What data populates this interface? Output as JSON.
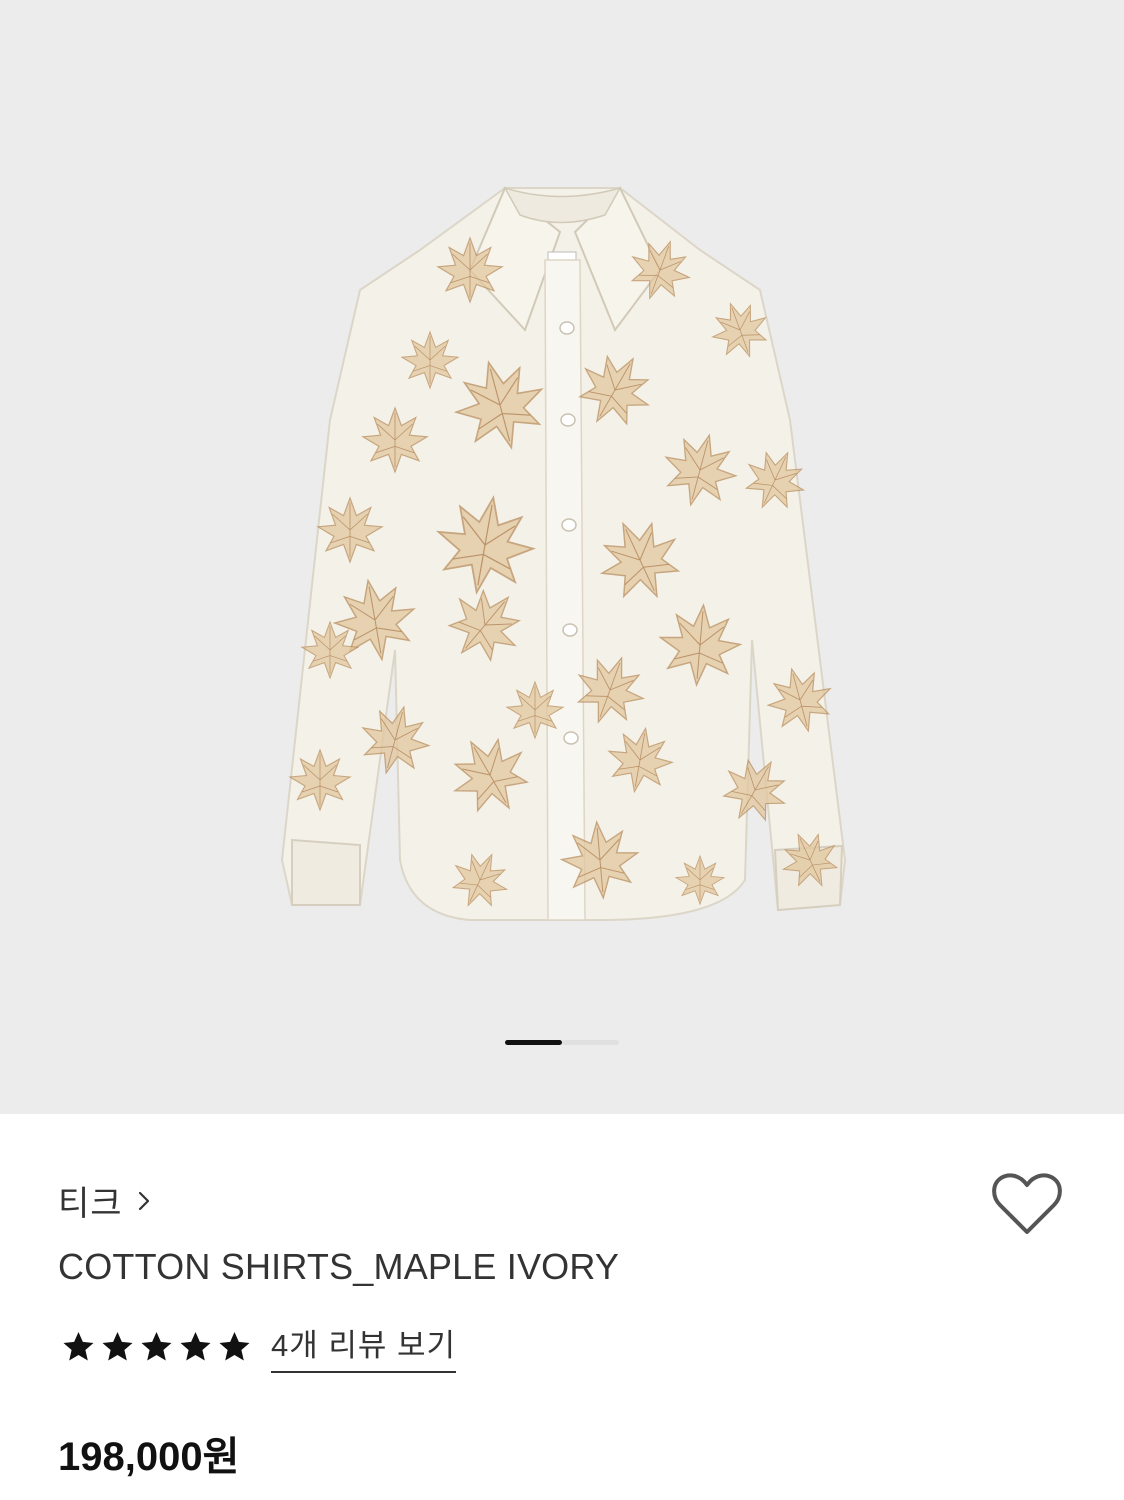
{
  "gallery": {
    "current_slide": 1,
    "total_slides": 2,
    "image_alt": "COTTON SHIRTS_MAPLE IVORY"
  },
  "product": {
    "brand": "티크",
    "name": "COTTON SHIRTS_MAPLE IVORY",
    "rating_stars": 5,
    "review_link": "4개 리뷰 보기",
    "price": "198,000원"
  },
  "icons": {
    "brand_arrow": "chevron-right-icon",
    "wishlist": "heart-outline-icon",
    "rating": "star-icon"
  },
  "colors": {
    "gallery_bg": "#ececec",
    "text": "#333333",
    "price": "#111111",
    "pager_active": "#111111"
  }
}
